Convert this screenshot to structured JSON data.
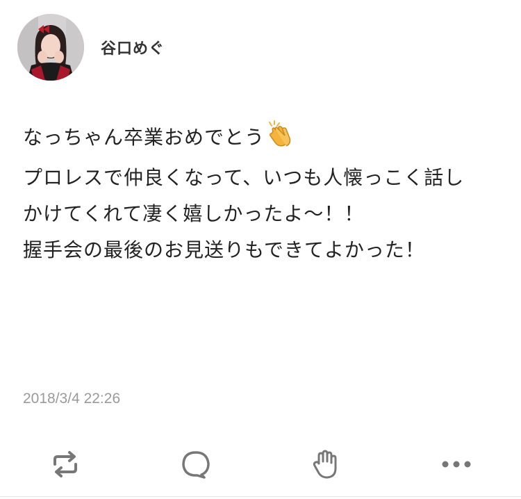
{
  "author": {
    "name": "谷口めぐ"
  },
  "post": {
    "lines": [
      "なっちゃん卒業おめでとう",
      "プロレスで仲良くなって、いつも人懐っこく話し",
      "かけてくれて凄く嬉しかったよ〜！！",
      "握手会の最後のお見送りもできてよかった！"
    ],
    "emoji": "clapping-hands-icon",
    "timestamp": "2018/3/4 22:26"
  },
  "actions": [
    {
      "icon": "repost-icon"
    },
    {
      "icon": "comment-icon"
    },
    {
      "icon": "clap-icon"
    },
    {
      "icon": "more-icon"
    }
  ],
  "colors": {
    "text": "#222222",
    "timestamp": "#9a9a9a",
    "icon": "#777777",
    "emoji": "#F5B33B"
  }
}
